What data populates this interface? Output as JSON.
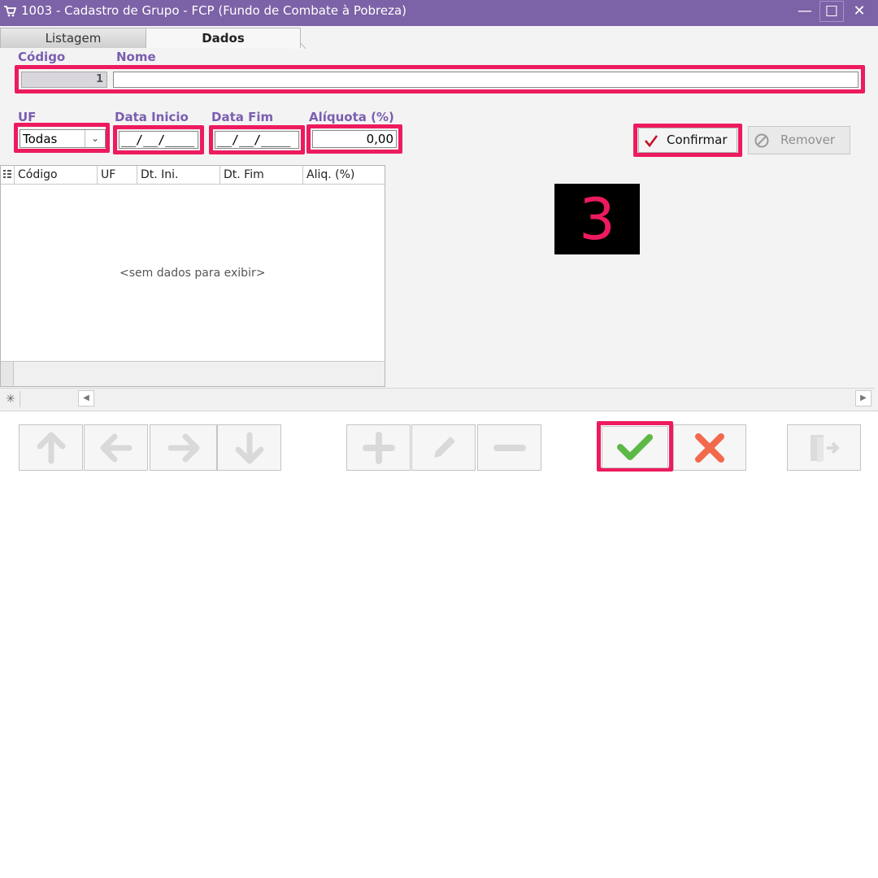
{
  "window": {
    "title": "1003 - Cadastro de Grupo - FCP (Fundo de Combate à Pobreza)",
    "minimize_glyph": "—",
    "maximize_glyph": "☐",
    "close_glyph": "✕"
  },
  "tabs": [
    {
      "label": "Listagem",
      "active": false
    },
    {
      "label": "Dados",
      "active": true
    }
  ],
  "form": {
    "codigo_label": "Código",
    "nome_label": "Nome",
    "codigo_value": "1",
    "nome_value": "",
    "uf_label": "UF",
    "uf_value": "Todas",
    "data_inicio_label": "Data Inicio",
    "data_inicio_value": "__/__/____",
    "data_fim_label": "Data Fim",
    "data_fim_value": "__/__/____",
    "aliquota_label": "Alíquota (%)",
    "aliquota_value": "0,00"
  },
  "buttons": {
    "confirmar": "Confirmar",
    "remover": "Remover"
  },
  "grid": {
    "columns": [
      "Código",
      "UF",
      "Dt. Ini.",
      "Dt. Fim",
      "Aliq. (%)"
    ],
    "empty_text": "<sem dados para exibir>"
  },
  "step_badge": "3",
  "colors": {
    "titlebar": "#7c62a6",
    "highlight": "#ed1b5e",
    "label": "#7a5eb0",
    "confirm_green": "#5db947",
    "cancel_orange": "#f2694b"
  },
  "icons": [
    "cart-icon",
    "arrow-up-icon",
    "arrow-left-icon",
    "arrow-right-icon",
    "arrow-down-icon",
    "plus-icon",
    "pencil-icon",
    "minus-icon",
    "check-icon",
    "close-x-icon",
    "exit-door-icon"
  ]
}
